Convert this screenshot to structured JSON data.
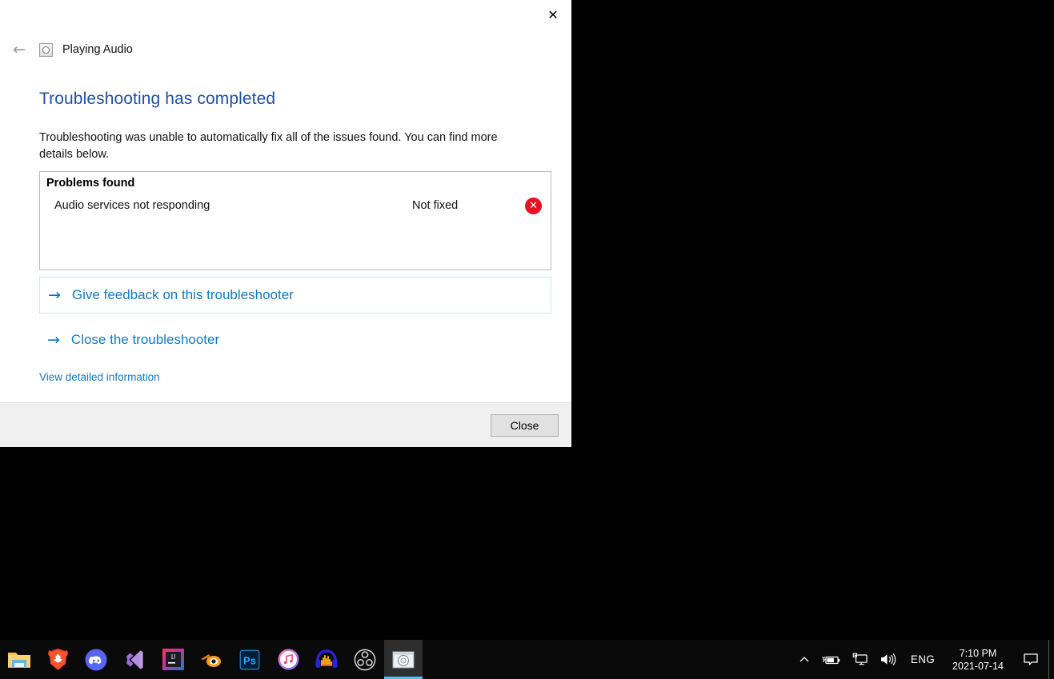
{
  "dialog": {
    "window_title": "Playing Audio",
    "close_icon": "close-icon",
    "back_icon": "back-arrow-icon",
    "titlebar_close_glyph": "✕",
    "back_glyph": "←",
    "heading": "Troubleshooting has completed",
    "description": "Troubleshooting was unable to automatically fix all of the issues found. You can find more details below.",
    "problems": {
      "title": "Problems found",
      "rows": [
        {
          "name": "Audio services not responding",
          "status": "Not fixed",
          "icon": "error-circle-icon",
          "icon_glyph": "✕",
          "icon_color": "#e81123"
        }
      ]
    },
    "actions": [
      {
        "label": "Give feedback on this troubleshooter",
        "arrow_glyph": "→",
        "icon": "arrow-right-icon",
        "hovered": true
      },
      {
        "label": "Close the troubleshooter",
        "arrow_glyph": "→",
        "icon": "arrow-right-icon",
        "hovered": false
      }
    ],
    "detail_link": "View detailed information",
    "footer": {
      "close_label": "Close"
    },
    "accent_heading_color": "#1f4fa8",
    "link_color": "#1379c9"
  },
  "taskbar": {
    "apps": [
      {
        "name": "file-explorer",
        "label": "File Explorer",
        "active": false
      },
      {
        "name": "brave-browser",
        "label": "Brave",
        "active": false
      },
      {
        "name": "discord",
        "label": "Discord",
        "active": false
      },
      {
        "name": "visual-studio-code",
        "label": "Visual Studio Code",
        "active": false
      },
      {
        "name": "intellij-idea",
        "label": "IntelliJ IDEA",
        "active": false
      },
      {
        "name": "blender",
        "label": "Blender",
        "active": false
      },
      {
        "name": "photoshop",
        "label": "Adobe Photoshop",
        "active": false
      },
      {
        "name": "itunes",
        "label": "iTunes",
        "active": false
      },
      {
        "name": "audacity",
        "label": "Audacity",
        "active": false
      },
      {
        "name": "obs-studio",
        "label": "OBS Studio",
        "active": false
      },
      {
        "name": "playing-audio-troubleshooter",
        "label": "Playing Audio",
        "active": true
      }
    ],
    "tray": {
      "chevron_glyph": "⌃",
      "icons": [
        "show-hidden-icons-icon",
        "battery-charging-icon",
        "network-display-icon",
        "volume-icon"
      ],
      "language": "ENG",
      "time": "7:10 PM",
      "date": "2021-07-14",
      "action_center_icon": "action-center-icon"
    }
  }
}
